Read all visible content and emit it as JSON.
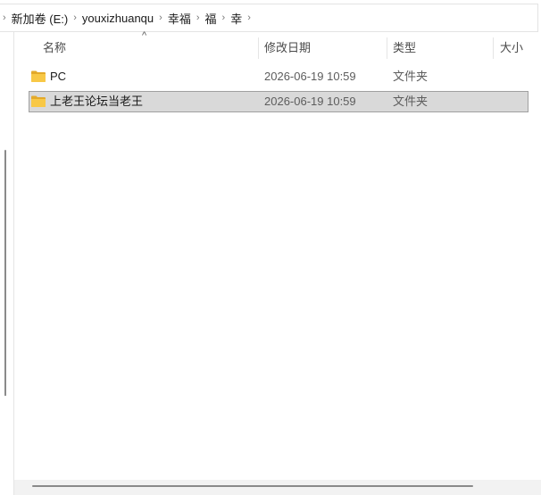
{
  "breadcrumb": {
    "items": [
      {
        "label": "新加卷 (E:)"
      },
      {
        "label": "youxizhuanqu"
      },
      {
        "label": "幸福"
      },
      {
        "label": "福"
      },
      {
        "label": "幸"
      }
    ],
    "separator": "›"
  },
  "columns": {
    "name": "名称",
    "modified": "修改日期",
    "type": "类型",
    "size": "大小",
    "sort_indicator": "^"
  },
  "files": [
    {
      "name": "PC",
      "modified": "2026-06-19 10:59",
      "type": "文件夹",
      "icon": "folder-icon",
      "selected": false
    },
    {
      "name": "上老王论坛当老王",
      "modified": "2026-06-19 10:59",
      "type": "文件夹",
      "icon": "folder-icon",
      "selected": true
    }
  ],
  "colors": {
    "folder": "#F8C846",
    "folder_dark": "#E3A92A",
    "selection": "#D9D9D9",
    "selection_border": "#A0A0A0"
  }
}
